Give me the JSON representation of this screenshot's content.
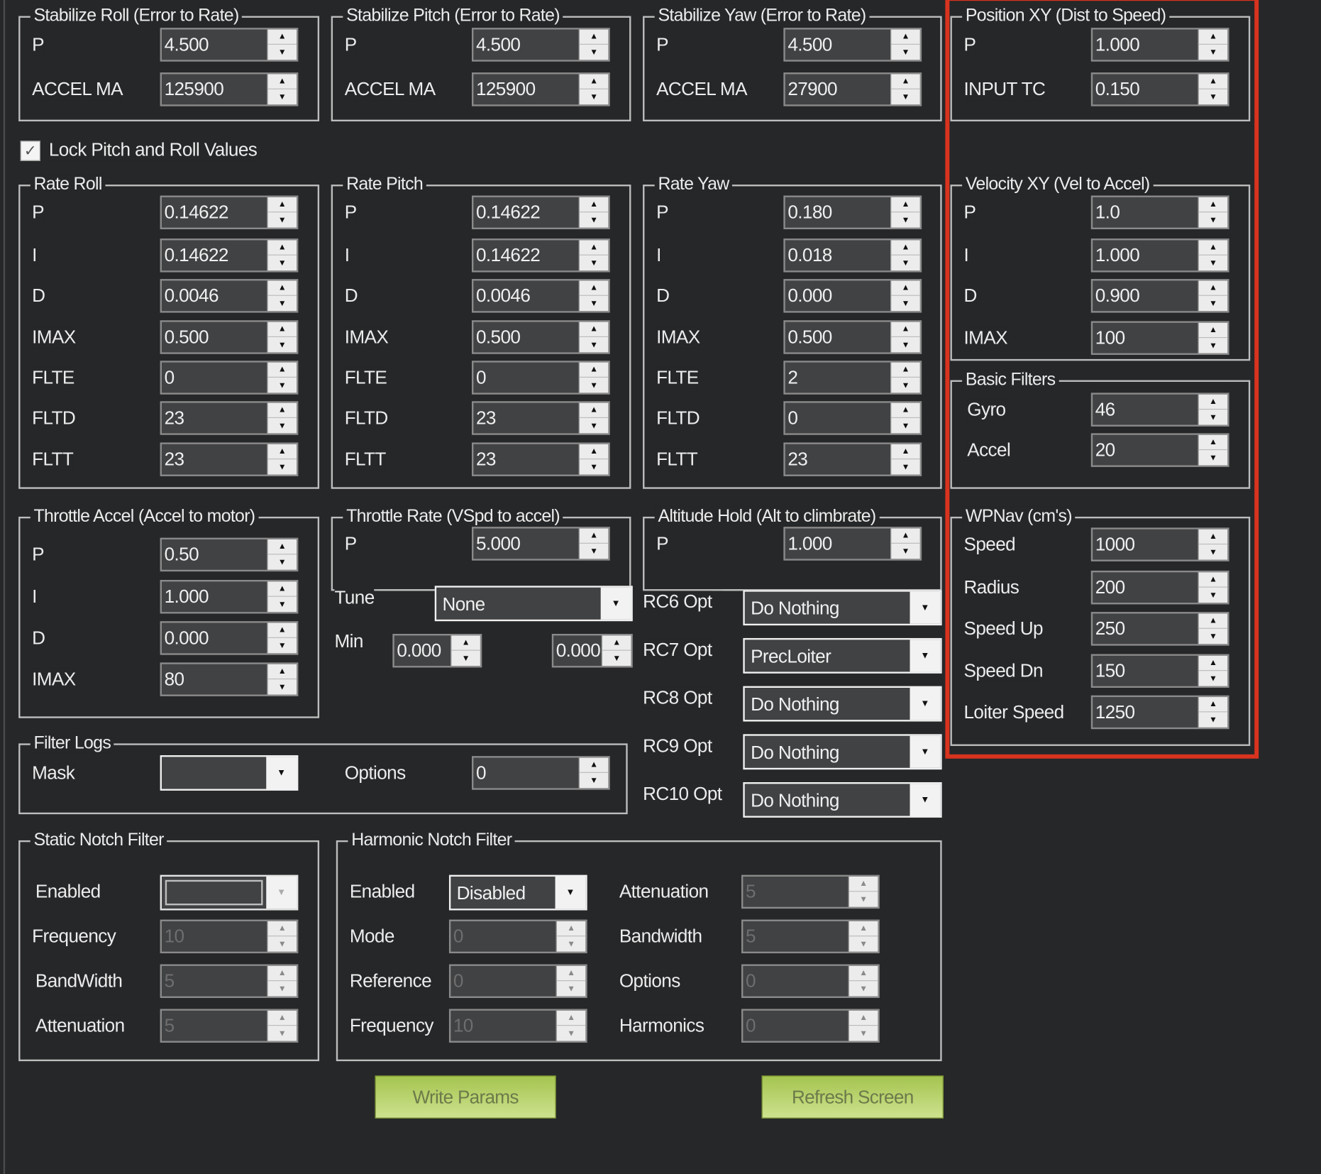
{
  "groups": {
    "stab_roll": {
      "title": "Stabilize Roll (Error to Rate)",
      "rows": [
        {
          "label": "P",
          "value": "4.500"
        },
        {
          "label": "ACCEL MA",
          "value": "125900"
        }
      ]
    },
    "stab_pitch": {
      "title": "Stabilize Pitch (Error to Rate)",
      "rows": [
        {
          "label": "P",
          "value": "4.500"
        },
        {
          "label": "ACCEL MA",
          "value": "125900"
        }
      ]
    },
    "stab_yaw": {
      "title": "Stabilize Yaw (Error to Rate)",
      "rows": [
        {
          "label": "P",
          "value": "4.500"
        },
        {
          "label": "ACCEL MA",
          "value": "27900"
        }
      ]
    },
    "pos_xy": {
      "title": "Position XY (Dist to Speed)",
      "rows": [
        {
          "label": "P",
          "value": "1.000"
        },
        {
          "label": "INPUT TC",
          "value": "0.150"
        }
      ]
    },
    "rate_roll": {
      "title": "Rate Roll",
      "rows": [
        {
          "label": "P",
          "value": "0.14622"
        },
        {
          "label": "I",
          "value": "0.14622"
        },
        {
          "label": "D",
          "value": "0.0046"
        },
        {
          "label": "IMAX",
          "value": "0.500"
        },
        {
          "label": "FLTE",
          "value": "0"
        },
        {
          "label": "FLTD",
          "value": "23"
        },
        {
          "label": "FLTT",
          "value": "23"
        }
      ]
    },
    "rate_pitch": {
      "title": "Rate Pitch",
      "rows": [
        {
          "label": "P",
          "value": "0.14622"
        },
        {
          "label": "I",
          "value": "0.14622"
        },
        {
          "label": "D",
          "value": "0.0046"
        },
        {
          "label": "IMAX",
          "value": "0.500"
        },
        {
          "label": "FLTE",
          "value": "0"
        },
        {
          "label": "FLTD",
          "value": "23"
        },
        {
          "label": "FLTT",
          "value": "23"
        }
      ]
    },
    "rate_yaw": {
      "title": "Rate Yaw",
      "rows": [
        {
          "label": "P",
          "value": "0.180"
        },
        {
          "label": "I",
          "value": "0.018"
        },
        {
          "label": "D",
          "value": "0.000"
        },
        {
          "label": "IMAX",
          "value": "0.500"
        },
        {
          "label": "FLTE",
          "value": "2"
        },
        {
          "label": "FLTD",
          "value": "0"
        },
        {
          "label": "FLTT",
          "value": "23"
        }
      ]
    },
    "vel_xy": {
      "title": "Velocity XY (Vel to Accel)",
      "rows": [
        {
          "label": "P",
          "value": "1.0"
        },
        {
          "label": "I",
          "value": "1.000"
        },
        {
          "label": "D",
          "value": "0.900"
        },
        {
          "label": "IMAX",
          "value": "100"
        }
      ]
    },
    "basic_filters": {
      "title": "Basic Filters",
      "rows": [
        {
          "label": "Gyro",
          "value": "46"
        },
        {
          "label": "Accel",
          "value": "20"
        }
      ]
    },
    "throttle_accel": {
      "title": "Throttle Accel (Accel to motor)",
      "rows": [
        {
          "label": "P",
          "value": "0.50"
        },
        {
          "label": "I",
          "value": "1.000"
        },
        {
          "label": "D",
          "value": "0.000"
        },
        {
          "label": "IMAX",
          "value": "80"
        }
      ]
    },
    "throttle_rate": {
      "title": "Throttle Rate (VSpd to accel)",
      "rows": [
        {
          "label": "P",
          "value": "5.000"
        }
      ]
    },
    "alt_hold": {
      "title": "Altitude Hold (Alt to climbrate)",
      "rows": [
        {
          "label": "P",
          "value": "1.000"
        }
      ]
    },
    "wpnav": {
      "title": "WPNav (cm's)",
      "rows": [
        {
          "label": "Speed",
          "value": "1000"
        },
        {
          "label": "Radius",
          "value": "200"
        },
        {
          "label": "Speed Up",
          "value": "250"
        },
        {
          "label": "Speed Dn",
          "value": "150"
        },
        {
          "label": "Loiter Speed",
          "value": "1250"
        }
      ]
    }
  },
  "lock": {
    "label": "Lock Pitch and Roll Values",
    "checked": true
  },
  "tune": {
    "label": "Tune",
    "value": "None",
    "min_label": "Min",
    "min_value": "0.000",
    "max_value": "0.000"
  },
  "rc_opts": [
    {
      "label": "RC6 Opt",
      "value": "Do Nothing"
    },
    {
      "label": "RC7 Opt",
      "value": "PrecLoiter"
    },
    {
      "label": "RC8 Opt",
      "value": "Do Nothing"
    },
    {
      "label": "RC9 Opt",
      "value": "Do Nothing"
    },
    {
      "label": "RC10 Opt",
      "value": "Do Nothing"
    }
  ],
  "filter_logs": {
    "title": "Filter Logs",
    "mask_label": "Mask",
    "mask_value": "",
    "options_label": "Options",
    "options_value": "0"
  },
  "static_notch": {
    "title": "Static Notch Filter",
    "enabled_label": "Enabled",
    "enabled_value": "",
    "rows": [
      {
        "label": "Frequency",
        "value": "10"
      },
      {
        "label": "BandWidth",
        "value": "5"
      },
      {
        "label": "Attenuation",
        "value": "5"
      }
    ]
  },
  "harmonic_notch": {
    "title": "Harmonic Notch Filter",
    "enabled_label": "Enabled",
    "enabled_value": "Disabled",
    "left": [
      {
        "label": "Mode",
        "value": "0"
      },
      {
        "label": "Reference",
        "value": "0"
      },
      {
        "label": "Frequency",
        "value": "10"
      }
    ],
    "right": [
      {
        "label": "Attenuation",
        "value": "5"
      },
      {
        "label": "Bandwidth",
        "value": "5"
      },
      {
        "label": "Options",
        "value": "0"
      },
      {
        "label": "Harmonics",
        "value": "0"
      }
    ]
  },
  "buttons": {
    "write": "Write Params",
    "refresh": "Refresh Screen"
  },
  "colors": {
    "background": "#262729",
    "highlight": "#d8331f",
    "button": "#b8d46e"
  }
}
